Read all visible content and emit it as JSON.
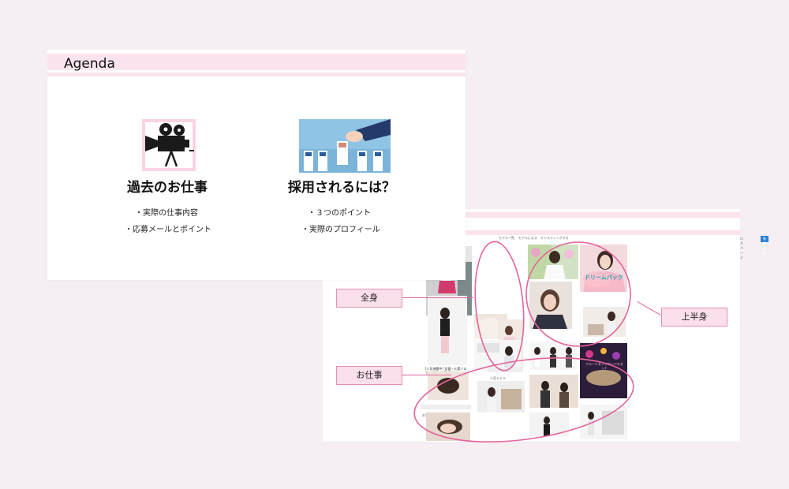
{
  "agenda_slide": {
    "title": "Agenda",
    "columns": [
      {
        "icon": "movie-camera-icon",
        "heading": "過去のお仕事",
        "items": [
          "・実際の仕事内容",
          "・応募メールとポイント"
        ]
      },
      {
        "icon": "profile-cards-icon",
        "heading": "採用されるには？",
        "items": [
          "・３つのポイント",
          "・実際のプロフィール"
        ]
      }
    ]
  },
  "screenshot_slide": {
    "nav": {
      "links": [
        "モデル一覧",
        "モデルになる",
        "キャスティングする"
      ],
      "top_link": "ログページ",
      "primary_button": "新規登録"
    },
    "captions": {
      "article_title": "[人気沸騰中] 女優・元素人まで、秘密の出演情報！",
      "small_label_1": "お知らせ",
      "grid_caption": "フルーツ＆フラワーバスセット",
      "pill_label": "人気モデル",
      "ad_banner_text": "ドリームパック"
    },
    "colors": {
      "accent_pink": "#e4649b",
      "band_pink": "#fbe4ee",
      "nav_blue": "#2a7fd4"
    }
  },
  "callouts": [
    {
      "label": "全身"
    },
    {
      "label": "お仕事"
    },
    {
      "label": "上半身"
    }
  ]
}
